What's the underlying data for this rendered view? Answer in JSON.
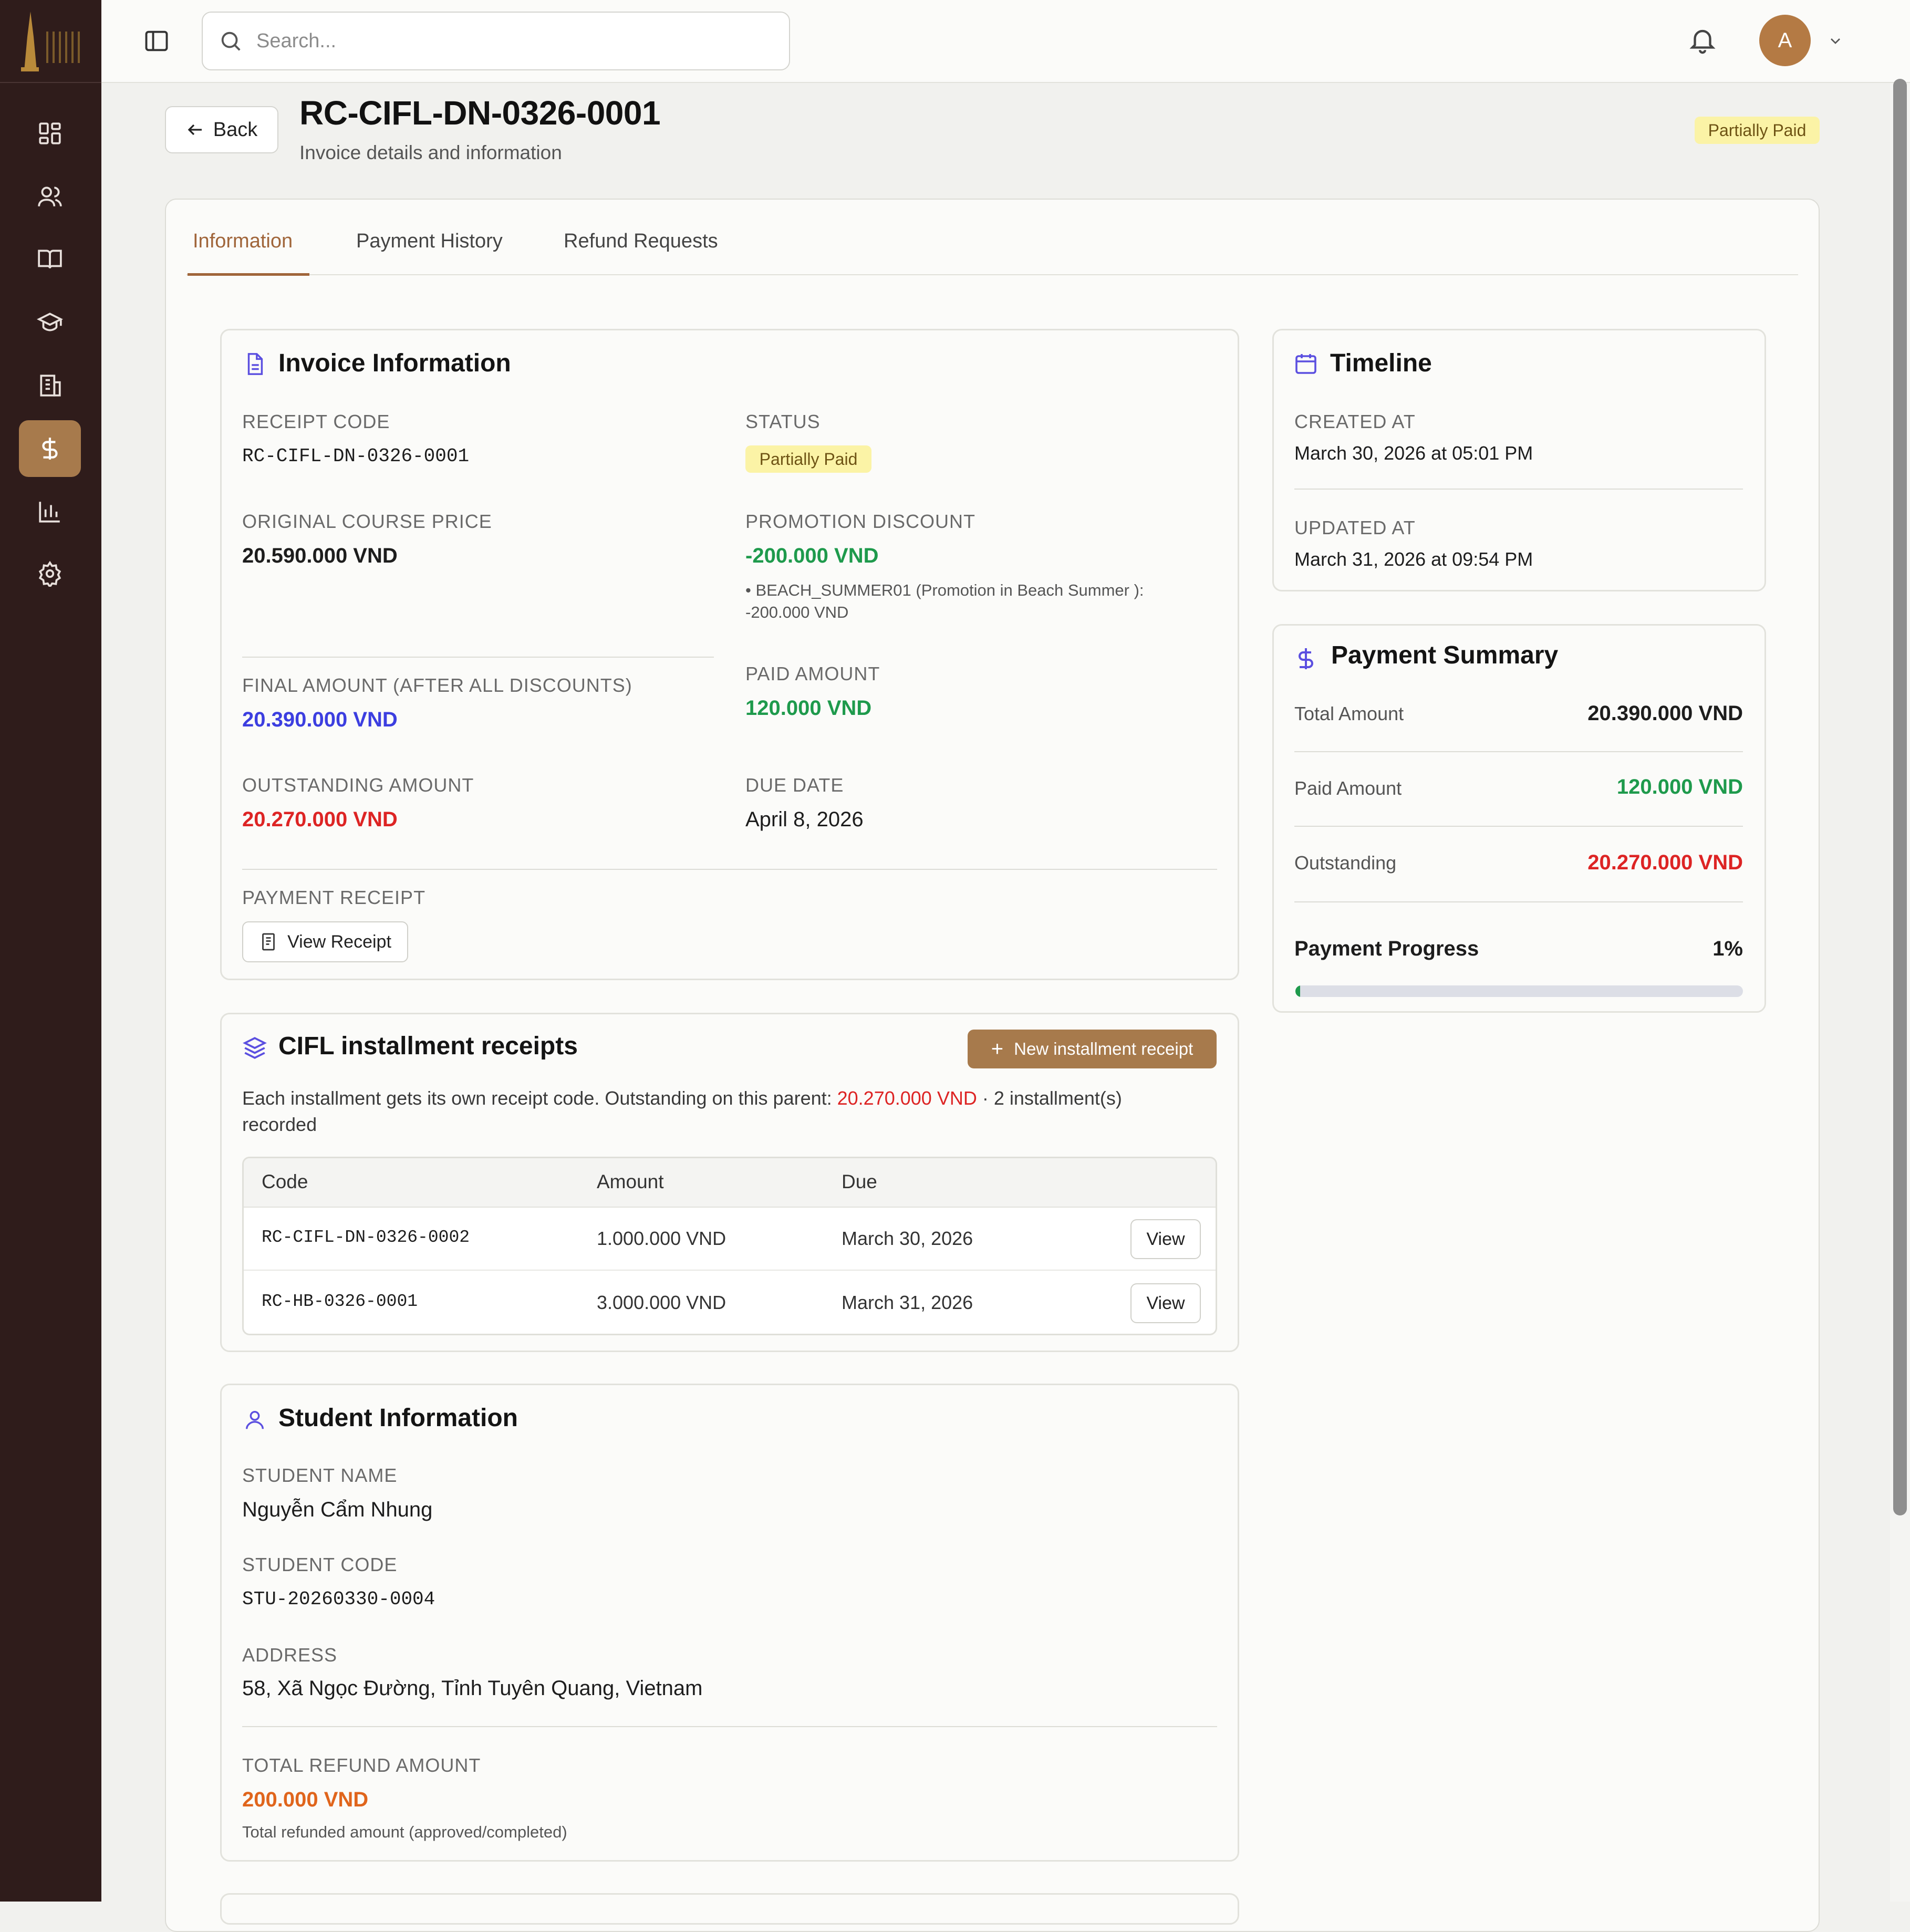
{
  "search": {
    "placeholder": "Search..."
  },
  "user": {
    "avatar_initial": "A"
  },
  "header": {
    "back_label": "Back",
    "title": "RC-CIFL-DN-0326-0001",
    "subtitle": "Invoice details and information",
    "status_badge": "Partially Paid"
  },
  "tabs": [
    {
      "label": "Information"
    },
    {
      "label": "Payment History"
    },
    {
      "label": "Refund Requests"
    }
  ],
  "invoice": {
    "title": "Invoice Information",
    "receipt_code_label": "RECEIPT CODE",
    "receipt_code": "RC-CIFL-DN-0326-0001",
    "status_label": "STATUS",
    "status": "Partially Paid",
    "original_price_label": "ORIGINAL COURSE PRICE",
    "original_price": "20.590.000 VND",
    "promotion_label": "PROMOTION DISCOUNT",
    "promotion_value": "-200.000 VND",
    "promotion_note_line1": "• BEACH_SUMMER01 (Promotion in Beach Summer ):",
    "promotion_note_line2": "-200.000 VND",
    "final_amount_label": "FINAL AMOUNT (AFTER ALL DISCOUNTS)",
    "final_amount": "20.390.000 VND",
    "paid_amount_label": "PAID AMOUNT",
    "paid_amount": "120.000 VND",
    "outstanding_label": "OUTSTANDING AMOUNT",
    "outstanding": "20.270.000 VND",
    "due_date_label": "DUE DATE",
    "due_date": "April 8, 2026",
    "payment_receipt_label": "PAYMENT RECEIPT",
    "view_receipt": "View Receipt"
  },
  "installments": {
    "title": "CIFL installment receipts",
    "new_button": "New installment receipt",
    "description_prefix": "Each installment gets its own receipt code. Outstanding on this parent: ",
    "description_amount": "20.270.000 VND",
    "description_suffix": " · 2 installment(s)",
    "description_line2": "recorded",
    "columns": [
      "Code",
      "Amount",
      "Due"
    ],
    "rows": [
      {
        "code": "RC-CIFL-DN-0326-0002",
        "amount": "1.000.000 VND",
        "due": "March 30, 2026",
        "action": "View"
      },
      {
        "code": "RC-HB-0326-0001",
        "amount": "3.000.000 VND",
        "due": "March 31, 2026",
        "action": "View"
      }
    ]
  },
  "student": {
    "title": "Student Information",
    "name_label": "STUDENT NAME",
    "name": "Nguyễn Cẩm Nhung",
    "code_label": "STUDENT CODE",
    "code": "STU-20260330-0004",
    "address_label": "ADDRESS",
    "address": "58, Xã Ngọc Đường, Tỉnh Tuyên Quang, Vietnam",
    "refund_label": "TOTAL REFUND AMOUNT",
    "refund_amount": "200.000 VND",
    "refund_note": "Total refunded amount (approved/completed)"
  },
  "timeline": {
    "title": "Timeline",
    "created_label": "CREATED AT",
    "created": "March 30, 2026 at 05:01 PM",
    "updated_label": "UPDATED AT",
    "updated": "March 31, 2026 at 09:54 PM"
  },
  "summary": {
    "title": "Payment Summary",
    "total_label": "Total Amount",
    "total": "20.390.000 VND",
    "paid_label": "Paid Amount",
    "paid": "120.000 VND",
    "outstanding_label": "Outstanding",
    "outstanding": "20.270.000 VND",
    "progress_label": "Payment Progress",
    "progress_text": "1%",
    "progress_fraction": 0.01
  },
  "colors": {
    "sidebar": "#2f1c1b",
    "accent": "#a77a4c",
    "green": "#1e9a4c",
    "red": "#dd2424",
    "blue": "#3c3ee0",
    "badge_bg": "#fbf3a6"
  },
  "sidebar_icons": [
    "dashboard-icon",
    "users-icon",
    "book-icon",
    "graduation-cap-icon",
    "building-icon",
    "dollar-icon",
    "chart-icon",
    "settings-icon"
  ]
}
